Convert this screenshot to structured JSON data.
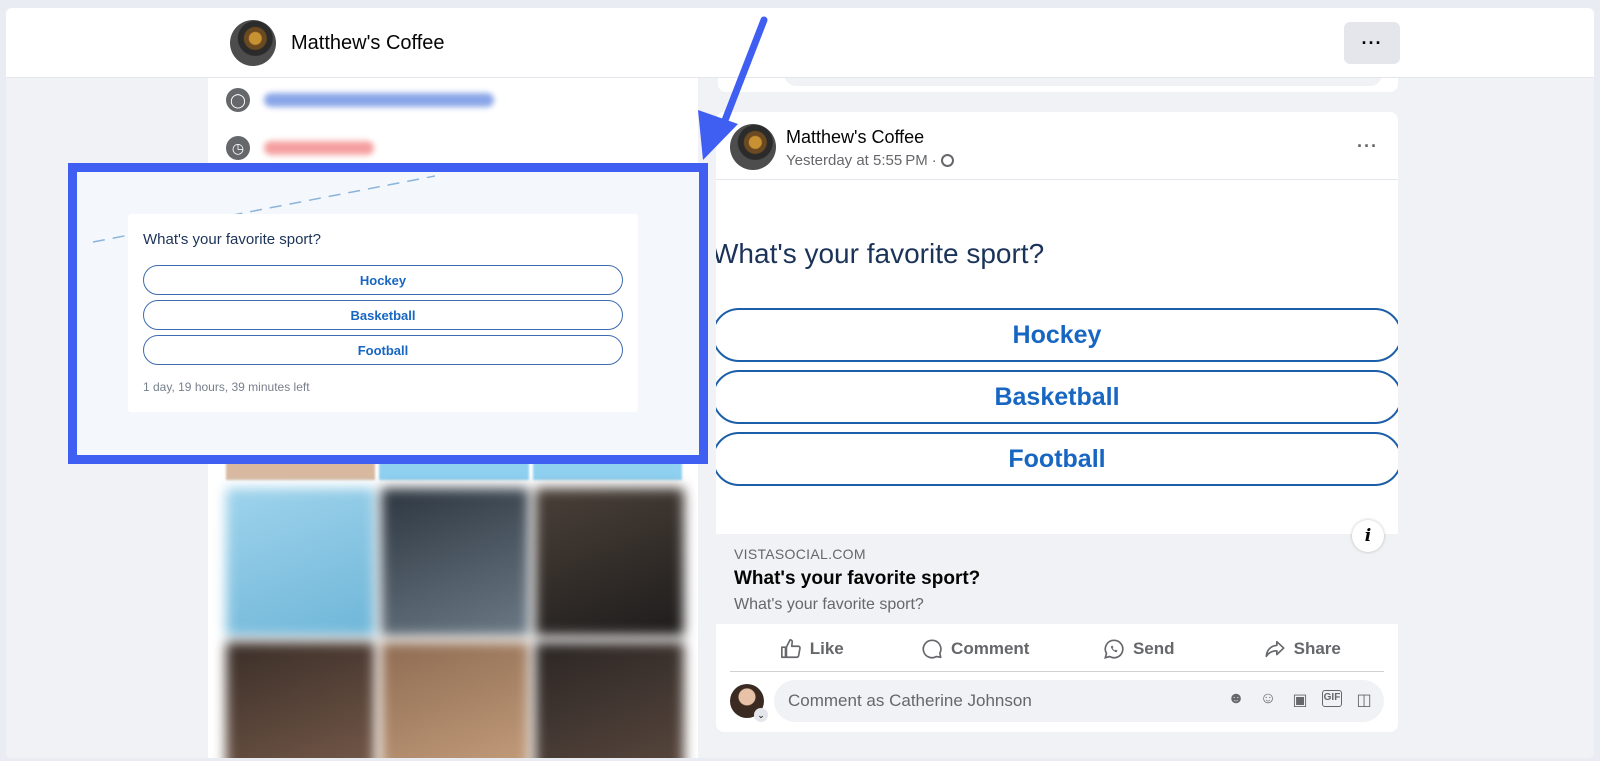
{
  "header": {
    "page_name": "Matthew's Coffee",
    "more_label": "···"
  },
  "post": {
    "author": "Matthew's Coffee",
    "time": "Yesterday at 5:55 PM",
    "separator": "·",
    "more_label": "···",
    "poll": {
      "question": "What's your favorite sport?",
      "options": [
        "Hockey",
        "Basketball",
        "Football"
      ]
    },
    "info_label": "i",
    "link": {
      "domain": "VISTASOCIAL.COM",
      "title": "What's your favorite sport?",
      "description": "What's your favorite sport?"
    },
    "actions": [
      {
        "label": "Like",
        "icon": "thumbs-up-icon"
      },
      {
        "label": "Comment",
        "icon": "comment-icon"
      },
      {
        "label": "Send",
        "icon": "messenger-icon"
      },
      {
        "label": "Share",
        "icon": "share-icon"
      }
    ],
    "comment": {
      "placeholder": "Comment as Catherine Johnson",
      "icons": [
        "avatar-sticker-icon",
        "emoji-icon",
        "camera-icon",
        "gif-icon",
        "sticker-icon"
      ]
    }
  },
  "highlight": {
    "question": "What's your favorite sport?",
    "options": [
      "Hockey",
      "Basketball",
      "Football"
    ],
    "time_left": "1 day, 19 hours, 39 minutes left"
  },
  "colors": {
    "accent": "#3f5ff3",
    "poll_text": "#1766c2",
    "question_text": "#1b3358"
  }
}
